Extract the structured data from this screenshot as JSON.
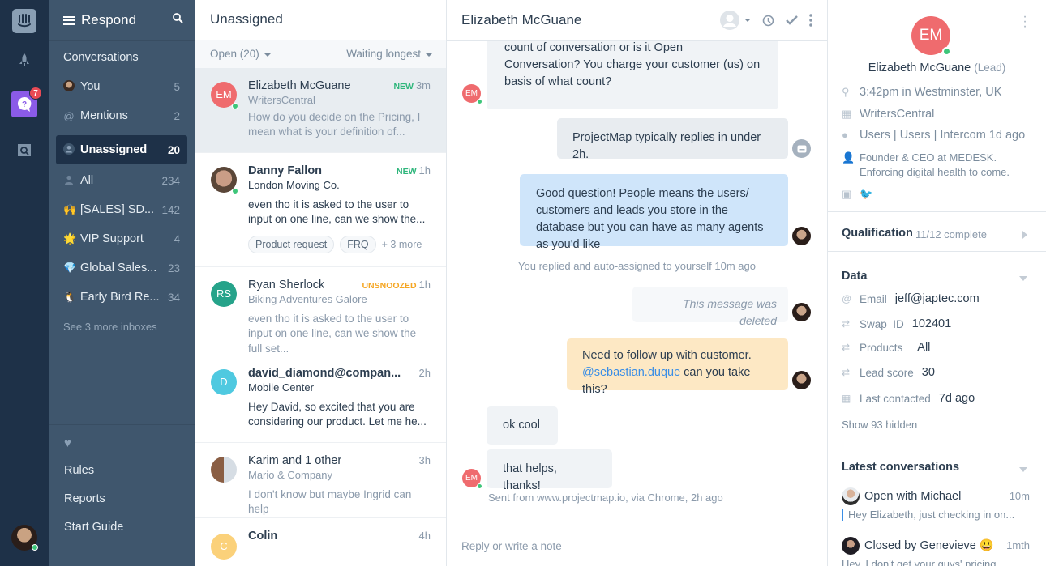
{
  "rail": {
    "notification_count": "7",
    "icons": [
      "intercom-logo-icon",
      "rocket-icon",
      "respond-icon",
      "knowledge-base-icon"
    ]
  },
  "nav": {
    "title": "Respond",
    "conversations_label": "Conversations",
    "items": [
      {
        "label": "You",
        "count": "5",
        "icon": "avatar"
      },
      {
        "label": "Mentions",
        "count": "2",
        "icon": "@"
      },
      {
        "label": "Unassigned",
        "count": "20",
        "icon": "person",
        "active": true
      },
      {
        "label": "All",
        "count": "234",
        "icon": "person"
      },
      {
        "label": "[SALES] SD...",
        "count": "142",
        "icon": "🙌"
      },
      {
        "label": "VIP Support",
        "count": "4",
        "icon": "🌟"
      },
      {
        "label": "Global Sales...",
        "count": "23",
        "icon": "💎"
      },
      {
        "label": "Early Bird Re...",
        "count": "34",
        "icon": "🐧"
      }
    ],
    "see_more": "See 3 more inboxes",
    "bottom": [
      "Rules",
      "Reports",
      "Start Guide"
    ]
  },
  "list": {
    "title": "Unassigned",
    "filter": "Open (20)",
    "sort": "Waiting longest",
    "conversations": [
      {
        "initials": "EM",
        "color": "#ef6b6e",
        "name": "Elizabeth McGuane",
        "tag": "NEW",
        "tag_color": "#2fb67c",
        "time": "3m",
        "company": "WritersCentral",
        "preview": "How do you decide on the Pricing, I mean what is your definition of...",
        "bold": false,
        "online": true,
        "selected": true
      },
      {
        "initials": "",
        "color": "#7a6a5e",
        "name": "Danny Fallon",
        "tag": "NEW",
        "tag_color": "#2fb67c",
        "time": "1h",
        "company": "London Moving Co.",
        "preview": "even tho it is asked to the user to input on one line, can we show the...",
        "bold": true,
        "online": true,
        "tags": [
          "Product request",
          "FRQ"
        ],
        "more": "+ 3 more"
      },
      {
        "initials": "RS",
        "color": "#26a38a",
        "name": "Ryan Sherlock",
        "tag": "UNSNOOZED",
        "tag_color": "#f5a623",
        "time": "1h",
        "company": "Biking Adventures Galore",
        "preview": "even tho it is asked to the user to input on one line, can we show the full set...",
        "bold": false
      },
      {
        "initials": "D",
        "color": "#4fc9e0",
        "name": "david_diamond@compan...",
        "tag": "",
        "time": "2h",
        "company": "Mobile Center",
        "preview": "Hey David, so excited that you are considering our product. Let me he...",
        "bold": true
      },
      {
        "initials": "",
        "color": "#b89b86",
        "name": "Karim and 1 other",
        "tag": "",
        "time": "3h",
        "company": "Mario & Company",
        "preview": "I don't know but maybe Ingrid can help",
        "bold": false
      },
      {
        "initials": "C",
        "color": "#fbd17a",
        "name": "Colin",
        "tag": "",
        "time": "4h",
        "company": "",
        "preview": "",
        "bold": true
      }
    ]
  },
  "chat": {
    "title": "Elizabeth McGuane",
    "messages": {
      "m1": "count of conversation or is it Open Conversation? You charge your customer (us) on basis of what count?",
      "m2": "ProjectMap typically replies in under 2h.",
      "m3": "Good question! People means the users/ customers and leads you store in the database but you can have as many agents as you'd like",
      "note": "You replied and auto-assigned to yourself 10m ago",
      "m4": "This message was deleted",
      "m5a": "Need to follow up with customer.",
      "m5_mention": "@sebastian.duque",
      "m5b": " can you take this?",
      "m6": "ok cool",
      "m7": "that helps, thanks!",
      "sent_from": "Sent from www.projectmap.io, via Chrome, 2h ago"
    },
    "user_initials": "EM",
    "reply_placeholder": "Reply or write a note"
  },
  "profile": {
    "initials": "EM",
    "name": "Elizabeth McGuane",
    "type": "(Lead)",
    "local_time": "3:42pm in Westminster, UK",
    "company": "WritersCentral",
    "segments": "Users | Users | Intercom 1d ago",
    "bio": "Founder & CEO at MEDESK. Enforcing digital health to come.",
    "qualification_label": "Qualification",
    "qualification_value": "11/12 complete",
    "data_label": "Data",
    "data": [
      {
        "icon": "@",
        "label": "Email",
        "value": "jeff@japtec.com"
      },
      {
        "icon": "⇄",
        "label": "Swap_ID",
        "value": "102401"
      },
      {
        "icon": "⇄",
        "label": "Products",
        "value": "All"
      },
      {
        "icon": "⇄",
        "label": "Lead score",
        "value": "30"
      },
      {
        "icon": "▦",
        "label": "Last contacted",
        "value": "7d ago"
      }
    ],
    "show_hidden": "Show 93 hidden",
    "latest_label": "Latest conversations",
    "latest": [
      {
        "status": "Open with ",
        "who": "Michael",
        "time": "10m",
        "preview": "Hey Elizabeth, just checking in on..."
      },
      {
        "status": "Closed by ",
        "who": "Genevieve",
        "emoji": "😃",
        "time": "1mth",
        "preview": "Hey, I don't get your guys' pricing"
      }
    ]
  }
}
